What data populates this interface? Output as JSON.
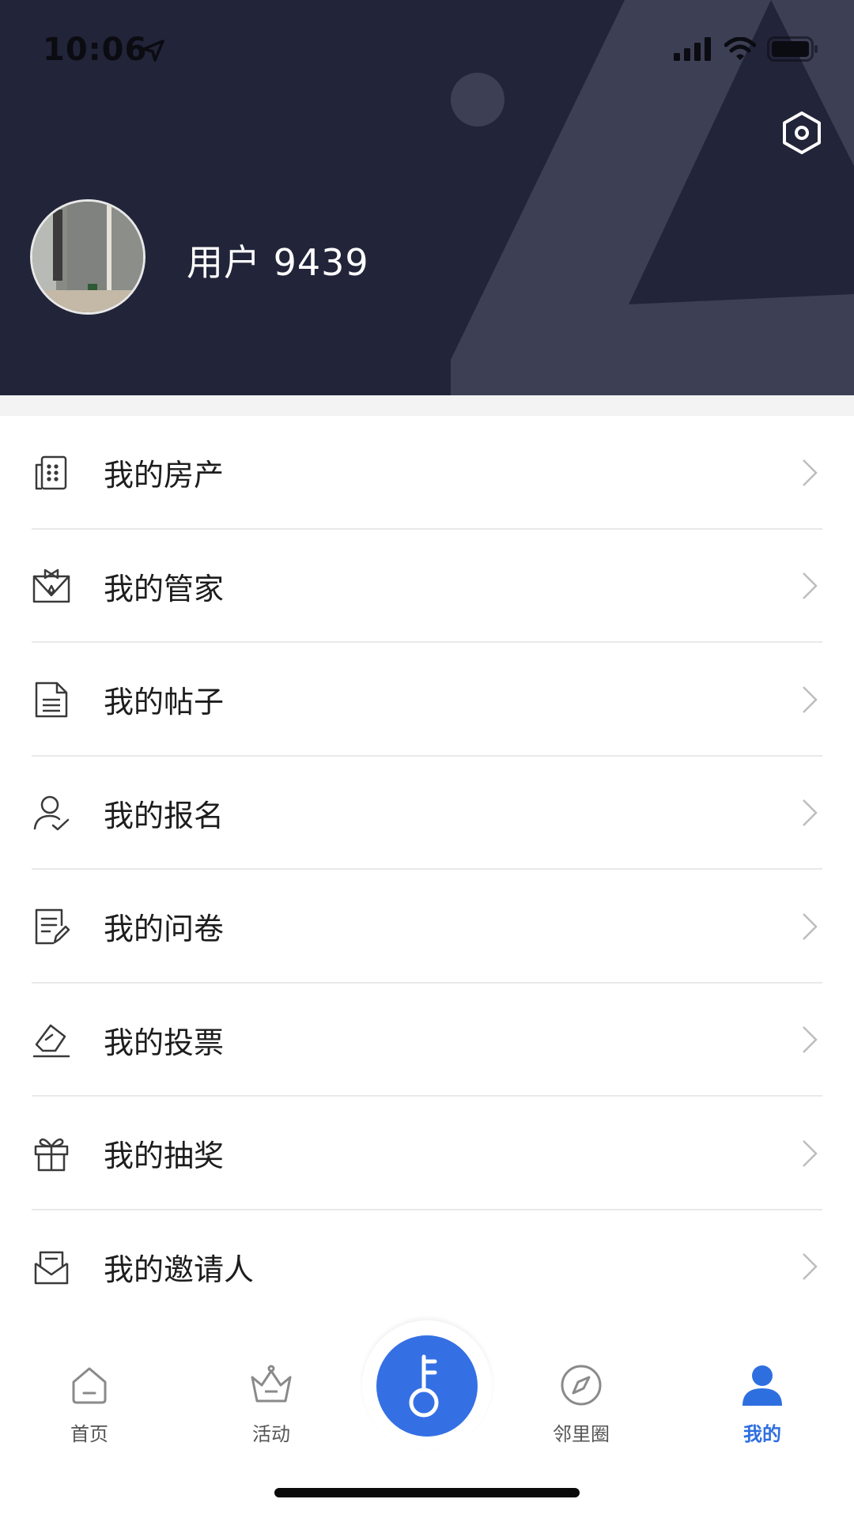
{
  "status_bar": {
    "time": "10:06",
    "icons": [
      "location-arrow-icon",
      "signal-icon",
      "wifi-icon",
      "battery-icon"
    ]
  },
  "header": {
    "username": "用户 9439",
    "settings_icon": "settings-hexagon-icon"
  },
  "menu": {
    "items": [
      {
        "label": "我的房产",
        "icon": "building-icon"
      },
      {
        "label": "我的管家",
        "icon": "butler-icon"
      },
      {
        "label": "我的帖子",
        "icon": "document-icon"
      },
      {
        "label": "我的报名",
        "icon": "user-check-icon"
      },
      {
        "label": "我的问卷",
        "icon": "questionnaire-icon"
      },
      {
        "label": "我的投票",
        "icon": "vote-icon"
      },
      {
        "label": "我的抽奖",
        "icon": "gift-icon"
      },
      {
        "label": "我的邀请人",
        "icon": "inbox-icon"
      }
    ]
  },
  "tabbar": {
    "tabs": [
      {
        "label": "首页",
        "icon": "home-icon"
      },
      {
        "label": "活动",
        "icon": "crown-icon"
      },
      {
        "label": "",
        "icon": "key-icon"
      },
      {
        "label": "邻里圈",
        "icon": "compass-icon"
      },
      {
        "label": "我的",
        "icon": "person-icon"
      }
    ],
    "active_tab": "我的",
    "active_color": "#2e6fe0",
    "center_color": "#3470e4"
  },
  "colors": {
    "header_bg": "#222439",
    "header_deco": "#3d3f55"
  }
}
